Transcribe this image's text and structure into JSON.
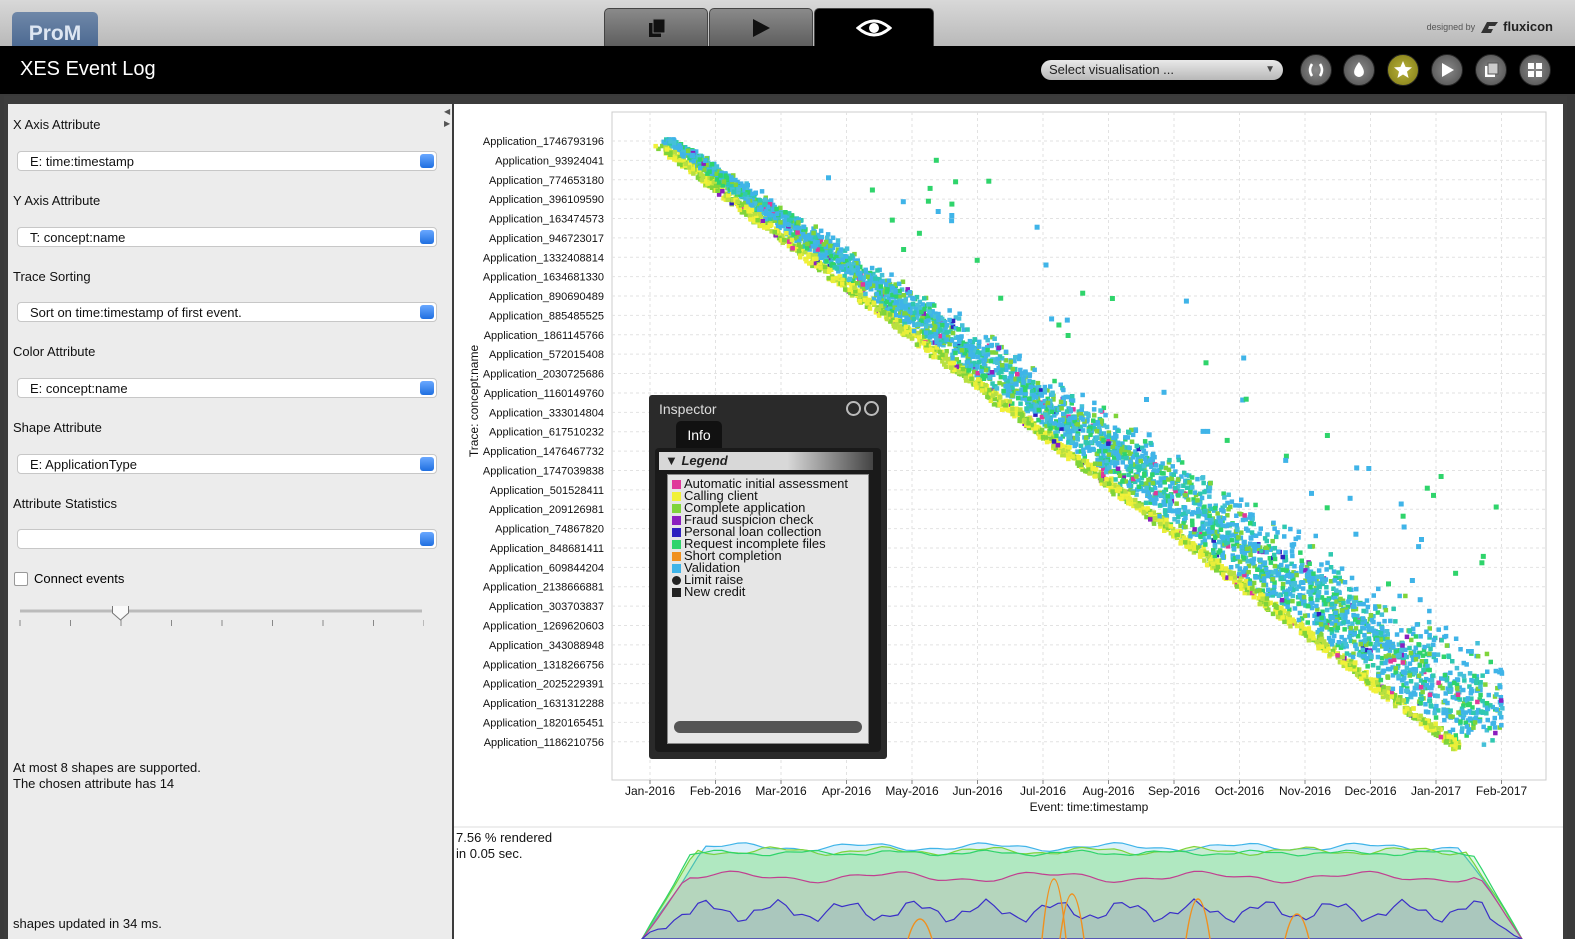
{
  "app": {
    "logo": "ProM",
    "designed_by": "designed by",
    "brand": "fluxicon"
  },
  "header": {
    "title": "XES Event Log",
    "select_vis": "Select visualisation ..."
  },
  "toolbar_icons": [
    "refresh-icon",
    "drop-icon",
    "star-icon",
    "play-icon",
    "copy-icon",
    "grid-icon"
  ],
  "view_tabs": [
    "copy-icon",
    "play-icon",
    "eye-icon"
  ],
  "left": {
    "x_axis_label": "X Axis Attribute",
    "x_axis_value": "E: time:timestamp",
    "y_axis_label": "Y Axis Attribute",
    "y_axis_value": "T: concept:name",
    "sorting_label": "Trace Sorting",
    "sorting_value": "Sort on time:timestamp of first event.",
    "color_label": "Color Attribute",
    "color_value": "E: concept:name",
    "shape_label": "Shape Attribute",
    "shape_value": "E: ApplicationType",
    "stats_label": "Attribute Statistics",
    "stats_value": "",
    "connect_label": "Connect events",
    "slider_value": 0.25,
    "msg1": "At most 8 shapes are supported.",
    "msg2": "The chosen attribute has 14",
    "msg3": "shapes updated in 34 ms."
  },
  "render_info": {
    "line1": "7.56 % rendered",
    "line2": "in 0.05 sec."
  },
  "inspector": {
    "title": "Inspector",
    "tab": "Info",
    "legend_title": "Legend",
    "items": [
      {
        "label": "Automatic initial assessment",
        "color": "#e0399a",
        "shape": "square"
      },
      {
        "label": "Calling client",
        "color": "#f1f138",
        "shape": "square"
      },
      {
        "label": "Complete application",
        "color": "#7fd43a",
        "shape": "square"
      },
      {
        "label": "Fraud suspicion check",
        "color": "#8b1fbf",
        "shape": "square"
      },
      {
        "label": "Personal loan collection",
        "color": "#2d1fbf",
        "shape": "square"
      },
      {
        "label": "Request incomplete files",
        "color": "#2fd46b",
        "shape": "square"
      },
      {
        "label": "Short completion",
        "color": "#f0901e",
        "shape": "square"
      },
      {
        "label": "Validation",
        "color": "#3fb4e8",
        "shape": "square"
      },
      {
        "label": "Limit raise",
        "color": "#222222",
        "shape": "circle"
      },
      {
        "label": "New credit",
        "color": "#222222",
        "shape": "square"
      }
    ]
  },
  "chart_data": {
    "type": "scatter",
    "xlabel": "Event: time:timestamp",
    "ylabel": "Trace: concept:name",
    "x_ticks": [
      "Jan-2016",
      "Feb-2016",
      "Mar-2016",
      "Apr-2016",
      "May-2016",
      "Jun-2016",
      "Jul-2016",
      "Aug-2016",
      "Sep-2016",
      "Oct-2016",
      "Nov-2016",
      "Dec-2016",
      "Jan-2017",
      "Feb-2017"
    ],
    "y_ticks": [
      "Application_1746793196",
      "Application_93924041",
      "Application_774653180",
      "Application_396109590",
      "Application_163474573",
      "Application_946723017",
      "Application_1332408814",
      "Application_1634681330",
      "Application_890690489",
      "Application_885485525",
      "Application_1861145766",
      "Application_572015408",
      "Application_2030725686",
      "Application_1160149760",
      "Application_333014804",
      "Application_617510232",
      "Application_1476467732",
      "Application_1747039838",
      "Application_501528411",
      "Application_209126981",
      "Application_74867820",
      "Application_848681411",
      "Application_609844204",
      "Application_2138666881",
      "Application_303703837",
      "Application_1269620603",
      "Application_343088948",
      "Application_1318266756",
      "Application_2025229391",
      "Application_1631312288",
      "Application_1820165451",
      "Application_1186210756"
    ],
    "grid": true
  }
}
